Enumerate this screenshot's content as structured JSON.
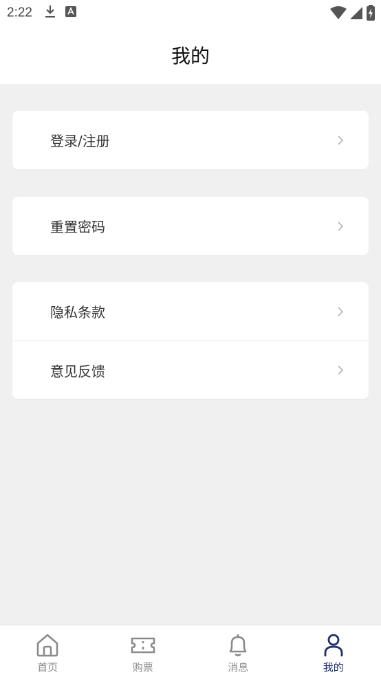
{
  "status_bar": {
    "time": "2:22"
  },
  "header": {
    "title": "我的"
  },
  "menu_groups": [
    {
      "items": [
        {
          "label": "登录/注册"
        }
      ]
    },
    {
      "items": [
        {
          "label": "重置密码"
        }
      ]
    },
    {
      "items": [
        {
          "label": "隐私条款"
        },
        {
          "label": "意见反馈"
        }
      ]
    }
  ],
  "tabbar": {
    "tabs": [
      {
        "label": "首页",
        "icon": "home-icon"
      },
      {
        "label": "购票",
        "icon": "ticket-icon"
      },
      {
        "label": "消息",
        "icon": "bell-icon"
      },
      {
        "label": "我的",
        "icon": "user-icon",
        "active": true
      }
    ]
  },
  "colors": {
    "background": "#f0f0f0",
    "active_tab": "#1f2d6b",
    "inactive_tab": "#8a8a8a"
  }
}
